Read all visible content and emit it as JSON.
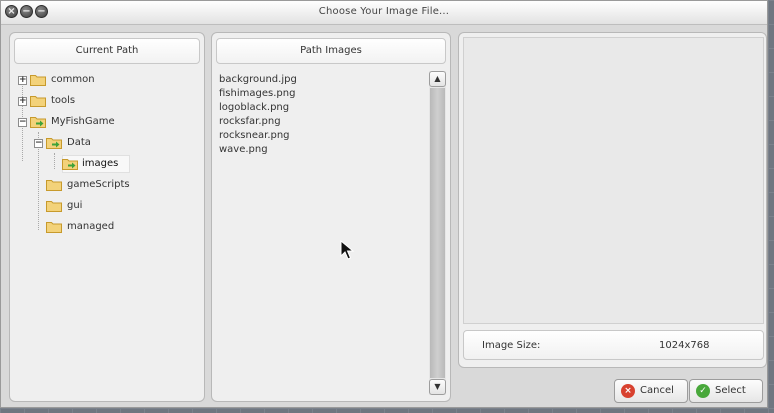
{
  "window": {
    "title": "Choose Your Image File..."
  },
  "left_panel": {
    "header": "Current Path",
    "tree": [
      {
        "label": "common",
        "depth": 0,
        "expanded": false,
        "has_children": true
      },
      {
        "label": "tools",
        "depth": 0,
        "expanded": false,
        "has_children": true
      },
      {
        "label": "MyFishGame",
        "depth": 0,
        "expanded": true,
        "has_children": true
      },
      {
        "label": "Data",
        "depth": 1,
        "expanded": true,
        "has_children": true
      },
      {
        "label": "images",
        "depth": 2,
        "expanded": false,
        "has_children": false,
        "selected": true
      },
      {
        "label": "gameScripts",
        "depth": 1,
        "expanded": false,
        "has_children": false
      },
      {
        "label": "gui",
        "depth": 1,
        "expanded": false,
        "has_children": false
      },
      {
        "label": "managed",
        "depth": 1,
        "expanded": false,
        "has_children": false
      }
    ]
  },
  "middle_panel": {
    "header": "Path Images",
    "files": [
      "background.jpg",
      "fishimages.png",
      "logoblack.png",
      "rocksfar.png",
      "rocksnear.png",
      "wave.png"
    ]
  },
  "right_panel": {
    "image_size_label": "Image Size:",
    "image_size_value": "1024x768"
  },
  "buttons": {
    "cancel": "Cancel",
    "select": "Select"
  },
  "icons": {
    "close": "close-icon",
    "minimize": "minimize-icon",
    "maximize": "maximize-icon",
    "folder": "folder-icon",
    "folder_open": "folder-open-icon",
    "cancel": "cancel-icon",
    "select": "check-icon",
    "scroll_up": "arrow-up-icon",
    "scroll_down": "arrow-down-icon"
  },
  "colors": {
    "folder": "#f3d27a",
    "folder_open_arrow": "#3fa33a",
    "cancel_icon": "#d8412f",
    "select_icon": "#49a83b"
  }
}
